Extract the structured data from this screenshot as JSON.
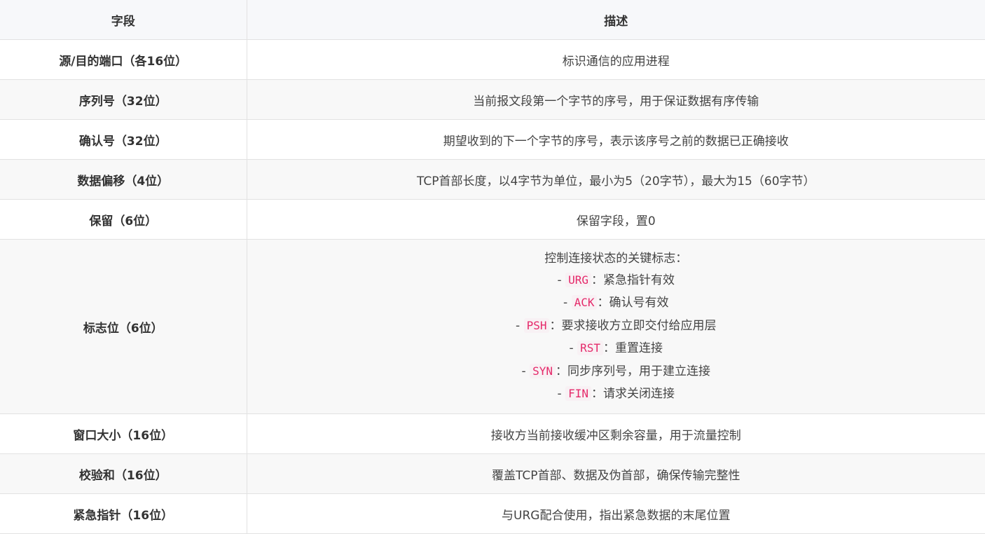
{
  "table": {
    "header": {
      "field": "字段",
      "description": "描述"
    },
    "rows": [
      {
        "field": "源/目的端口（各16位）",
        "description": "标识通信的应用进程"
      },
      {
        "field": "序列号（32位）",
        "description": "当前报文段第一个字节的序号，用于保证数据有序传输"
      },
      {
        "field": "确认号（32位）",
        "description": "期望收到的下一个字节的序号，表示该序号之前的数据已正确接收"
      },
      {
        "field": "数据偏移（4位）",
        "description": "TCP首部长度，以4字节为单位，最小为5（20字节），最大为15（60字节）"
      },
      {
        "field": "保留（6位）",
        "description": "保留字段，置0"
      },
      {
        "field": "标志位（6位）",
        "description_intro": "控制连接状态的关键标志：",
        "flags": [
          {
            "prefix": "- ",
            "code": "URG",
            "text": "：紧急指针有效"
          },
          {
            "prefix": "- ",
            "code": "ACK",
            "text": "：确认号有效"
          },
          {
            "prefix": "- ",
            "code": "PSH",
            "text": "：要求接收方立即交付给应用层"
          },
          {
            "prefix": "- ",
            "code": "RST",
            "text": "：重置连接"
          },
          {
            "prefix": "- ",
            "code": "SYN",
            "text": "：同步序列号，用于建立连接"
          },
          {
            "prefix": "- ",
            "code": "FIN",
            "text": "：请求关闭连接"
          }
        ]
      },
      {
        "field": "窗口大小（16位）",
        "description": "接收方当前接收缓冲区剩余容量，用于流量控制"
      },
      {
        "field": "校验和（16位）",
        "description": "覆盖TCP首部、数据及伪首部，确保传输完整性"
      },
      {
        "field": "紧急指针（16位）",
        "description": "与URG配合使用，指出紧急数据的末尾位置"
      }
    ]
  }
}
